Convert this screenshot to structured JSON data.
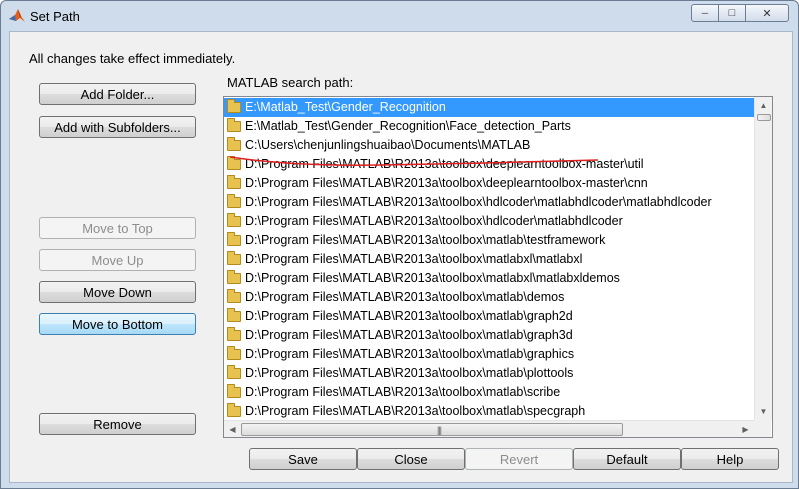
{
  "window": {
    "title": "Set Path",
    "minimize_glyph": "─",
    "maximize_glyph": "□",
    "close_glyph": "✕"
  },
  "info_text": "All changes take effect immediately.",
  "path_label": "MATLAB search path:",
  "buttons": {
    "add_folder": "Add Folder...",
    "add_subfolders": "Add with Subfolders...",
    "move_top": "Move to Top",
    "move_up": "Move Up",
    "move_down": "Move Down",
    "move_bottom": "Move to Bottom",
    "remove": "Remove",
    "save": "Save",
    "close": "Close",
    "revert": "Revert",
    "default": "Default",
    "help": "Help"
  },
  "scroll": {
    "up_arrow": "▲",
    "down_arrow": "▼",
    "left_arrow": "◀",
    "right_arrow": "▶",
    "grip": "|||"
  },
  "paths": [
    "E:\\Matlab_Test\\Gender_Recognition",
    "E:\\Matlab_Test\\Gender_Recognition\\Face_detection_Parts",
    "C:\\Users\\chenjunlingshuaibao\\Documents\\MATLAB",
    "D:\\Program Files\\MATLAB\\R2013a\\toolbox\\deeplearntoolbox-master\\util",
    "D:\\Program Files\\MATLAB\\R2013a\\toolbox\\deeplearntoolbox-master\\cnn",
    "D:\\Program Files\\MATLAB\\R2013a\\toolbox\\hdlcoder\\matlabhdlcoder\\matlabhdlcoder",
    "D:\\Program Files\\MATLAB\\R2013a\\toolbox\\hdlcoder\\matlabhdlcoder",
    "D:\\Program Files\\MATLAB\\R2013a\\toolbox\\matlab\\testframework",
    "D:\\Program Files\\MATLAB\\R2013a\\toolbox\\matlabxl\\matlabxl",
    "D:\\Program Files\\MATLAB\\R2013a\\toolbox\\matlabxl\\matlabxldemos",
    "D:\\Program Files\\MATLAB\\R2013a\\toolbox\\matlab\\demos",
    "D:\\Program Files\\MATLAB\\R2013a\\toolbox\\matlab\\graph2d",
    "D:\\Program Files\\MATLAB\\R2013a\\toolbox\\matlab\\graph3d",
    "D:\\Program Files\\MATLAB\\R2013a\\toolbox\\matlab\\graphics",
    "D:\\Program Files\\MATLAB\\R2013a\\toolbox\\matlab\\plottools",
    "D:\\Program Files\\MATLAB\\R2013a\\toolbox\\matlab\\scribe",
    "D:\\Program Files\\MATLAB\\R2013a\\toolbox\\matlab\\specgraph"
  ],
  "selected_index": 0,
  "colors": {
    "selection": "#3399ff",
    "annotation": "#e02020"
  }
}
